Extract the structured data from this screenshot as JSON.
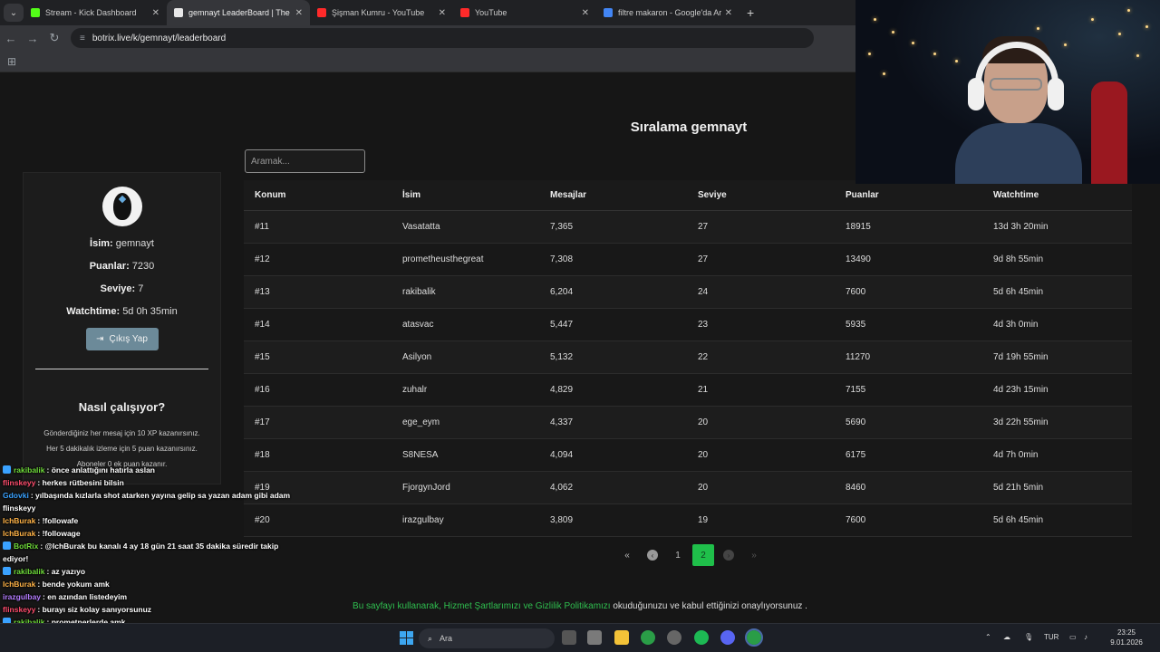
{
  "browser": {
    "tabs": [
      {
        "title": "Stream - Kick Dashboard",
        "color": "#53fc18"
      },
      {
        "title": "gemnayt LeaderBoard | The be",
        "color": "#e8e8e8"
      },
      {
        "title": "Şişman Kumru - YouTube",
        "color": "#ff2a2a"
      },
      {
        "title": "YouTube",
        "color": "#ff2a2a"
      },
      {
        "title": "filtre makaron - Google'da Ara",
        "color": "#4285f4"
      }
    ],
    "url": "botrix.live/k/gemnayt/leaderboard"
  },
  "page": {
    "title": "Sıralama gemnayt",
    "search_placeholder": "Aramak...",
    "profile": {
      "name_label": "İsim:",
      "name_value": "gemnayt",
      "points_label": "Puanlar:",
      "points_value": "7230",
      "level_label": "Seviye:",
      "level_value": "7",
      "watch_label": "Watchtime:",
      "watch_value": "5d 0h 35min",
      "logout_label": "Çıkış Yap",
      "how_title": "Nasıl çalışıyor?",
      "info_1": "Gönderdiğiniz her mesaj için 10 XP kazanırsınız.",
      "info_2": "Her 5 dakikalık izleme için 5 puan kazanırsınız.",
      "info_3": "Aboneler 0 ek puan kazanır."
    },
    "table": {
      "headers": [
        "Konum",
        "İsim",
        "Mesajlar",
        "Seviye",
        "Puanlar",
        "Watchtime"
      ],
      "rows": [
        [
          "#11",
          "Vasatatta",
          "7,365",
          "27",
          "18915",
          "13d 3h 20min"
        ],
        [
          "#12",
          "prometheusthegreat",
          "7,308",
          "27",
          "13490",
          "9d 8h 55min"
        ],
        [
          "#13",
          "rakibalik",
          "6,204",
          "24",
          "7600",
          "5d 6h 45min"
        ],
        [
          "#14",
          "atasvac",
          "5,447",
          "23",
          "5935",
          "4d 3h 0min"
        ],
        [
          "#15",
          "Asilyon",
          "5,132",
          "22",
          "11270",
          "7d 19h 55min"
        ],
        [
          "#16",
          "zuhalr",
          "4,829",
          "21",
          "7155",
          "4d 23h 15min"
        ],
        [
          "#17",
          "ege_eym",
          "4,337",
          "20",
          "5690",
          "3d 22h 55min"
        ],
        [
          "#18",
          "S8NESA",
          "4,094",
          "20",
          "6175",
          "4d 7h 0min"
        ],
        [
          "#19",
          "FjorgynJord",
          "4,062",
          "20",
          "8460",
          "5d 21h 5min"
        ],
        [
          "#20",
          "irazgulbay",
          "3,809",
          "19",
          "7600",
          "5d 6h 45min"
        ]
      ]
    },
    "pagination": {
      "first": "«",
      "prev": "‹",
      "page1": "1",
      "page2": "2",
      "next": "›",
      "last": "»"
    },
    "footer": {
      "prefix": "Bu sayfayı kullanarak, ",
      "link1": "Hizmet Şartlarımızı",
      "mid": " ve ",
      "link2": "Gizlilik Politikamızı",
      "suffix": " okuduğunuzu ve kabul ettiğinizi onaylıyorsunuz ."
    }
  },
  "chat": [
    {
      "user": "rakibalik",
      "color": "#6fdc3a",
      "text": ": önce anlattığını hatırla aslan",
      "badge": true
    },
    {
      "user": "flinskeyy",
      "color": "#ff4d6d",
      "text": ": herkes rütbesini bilsin",
      "badge": false
    },
    {
      "user": "Gdovki",
      "color": "#3aa2ff",
      "text": ": yılbaşında kızlarla shot atarken yayına gelip sa yazan adam gibi adam flinskeyy",
      "badge": false
    },
    {
      "user": "IchBurak",
      "color": "#ffb347",
      "text": ": !followafe",
      "badge": false
    },
    {
      "user": "IchBurak",
      "color": "#ffb347",
      "text": ": !followage",
      "badge": false
    },
    {
      "user": "BotRix",
      "color": "#6fdc3a",
      "text": ": @IchBurak bu kanalı 4 ay 18 gün 21 saat 35 dakika süredir takip ediyor!",
      "badge": true
    },
    {
      "user": "rakibalik",
      "color": "#6fdc3a",
      "text": ": az yazıyo",
      "badge": true
    },
    {
      "user": "IchBurak",
      "color": "#ffb347",
      "text": ": bende yokum amk",
      "badge": false
    },
    {
      "user": "irazgulbay",
      "color": "#b47cff",
      "text": ": en azından listedeyim",
      "badge": false
    },
    {
      "user": "flinskeyy",
      "color": "#ff4d6d",
      "text": ": burayı siz kolay sanıyorsunuz",
      "badge": false
    },
    {
      "user": "rakibalik",
      "color": "#6fdc3a",
      "text": ": prometnerlerde amk",
      "badge": true
    }
  ],
  "taskbar": {
    "search": "Ara",
    "lang": "TUR",
    "time": "23:25",
    "date": "9.01.2026"
  }
}
